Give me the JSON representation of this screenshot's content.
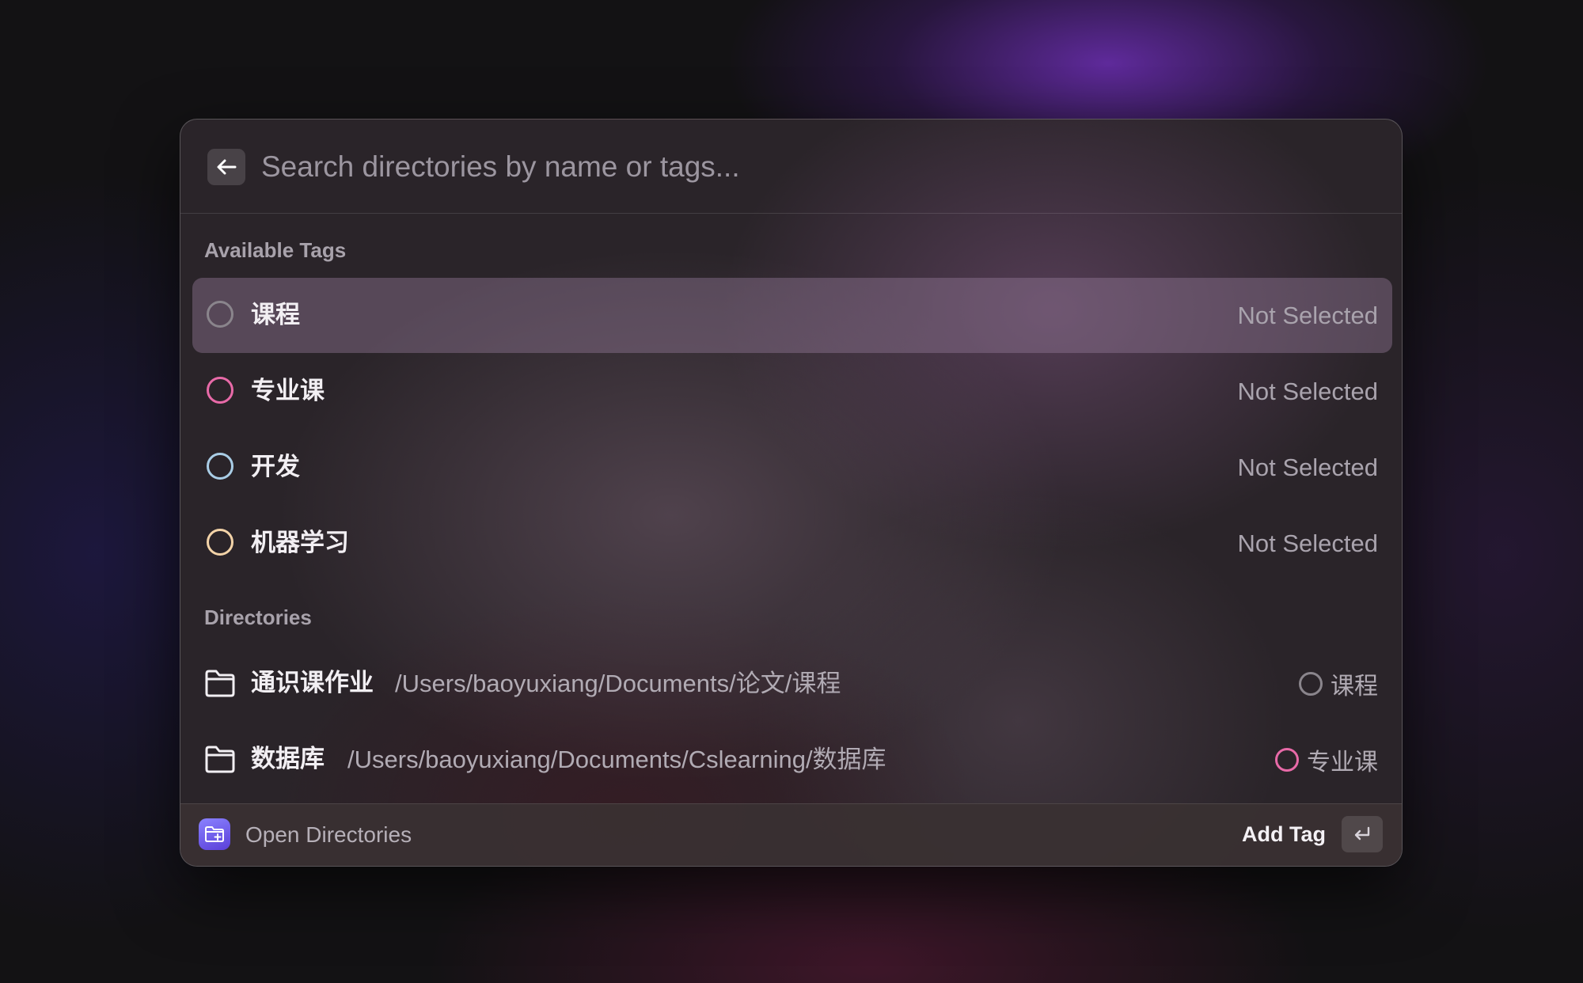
{
  "search": {
    "placeholder": "Search directories by name or tags...",
    "value": ""
  },
  "sections": {
    "tags_title": "Available Tags",
    "directories_title": "Directories"
  },
  "tags": [
    {
      "name": "课程",
      "status": "Not Selected",
      "color": "#8a858c",
      "selected_row": true
    },
    {
      "name": "专业课",
      "status": "Not Selected",
      "color": "#e86aa8",
      "selected_row": false
    },
    {
      "name": "开发",
      "status": "Not Selected",
      "color": "#a9cde6",
      "selected_row": false
    },
    {
      "name": "机器学习",
      "status": "Not Selected",
      "color": "#f3d3a8",
      "selected_row": false
    }
  ],
  "directories": [
    {
      "name": "通识课作业",
      "path": "/Users/baoyuxiang/Documents/论文/课程",
      "tag": "课程",
      "tag_color": "#8a858c",
      "icon": "folder-icon"
    },
    {
      "name": "数据库",
      "path": "/Users/baoyuxiang/Documents/Cslearning/数据库",
      "tag": "专业课",
      "tag_color": "#e86aa8",
      "icon": "folder-icon"
    }
  ],
  "footer": {
    "app_label": "Open Directories",
    "action_label": "Add Tag",
    "action_key_icon": "return-key-icon"
  }
}
